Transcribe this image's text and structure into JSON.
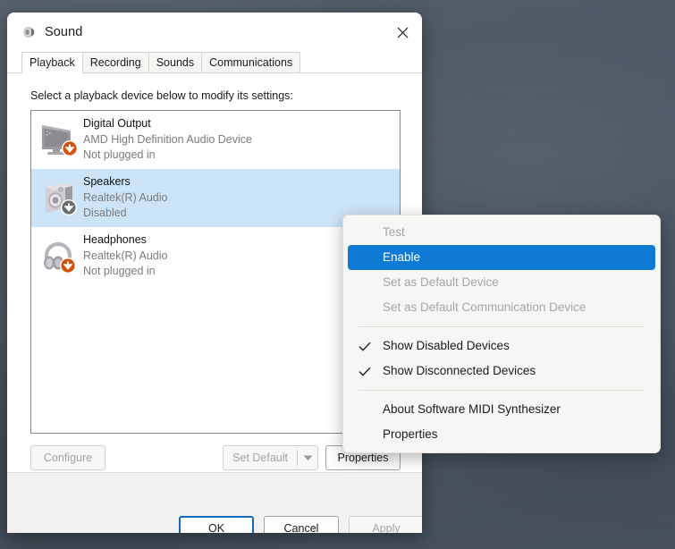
{
  "window": {
    "title": "Sound",
    "title_icon": "speaker-icon",
    "close_label": "Close",
    "close_icon": "close-icon"
  },
  "tabs": [
    {
      "label": "Playback",
      "active": true
    },
    {
      "label": "Recording",
      "active": false
    },
    {
      "label": "Sounds",
      "active": false
    },
    {
      "label": "Communications",
      "active": false
    }
  ],
  "playback": {
    "hint": "Select a playback device below to modify its settings:",
    "devices": [
      {
        "name": "Digital Output",
        "driver": "AMD High Definition Audio Device",
        "status": "Not plugged in",
        "icon": "monitor-icon",
        "badge": "down-arrow-badge",
        "badge_color": "#d4520f",
        "selected": false,
        "disabled_look": false
      },
      {
        "name": "Speakers",
        "driver": "Realtek(R) Audio",
        "status": "Disabled",
        "icon": "speaker-box-icon",
        "badge": "down-arrow-badge",
        "badge_color": "#6d6d6d",
        "selected": true,
        "disabled_look": true
      },
      {
        "name": "Headphones",
        "driver": "Realtek(R) Audio",
        "status": "Not plugged in",
        "icon": "headphones-icon",
        "badge": "down-arrow-badge",
        "badge_color": "#d4520f",
        "selected": false,
        "disabled_look": false
      }
    ]
  },
  "actions": {
    "configure": "Configure",
    "set_default": "Set Default",
    "set_default_arrow_icon": "chevron-down-icon",
    "properties": "Properties"
  },
  "footer": {
    "ok": "OK",
    "cancel": "Cancel",
    "apply": "Apply"
  },
  "context_menu": {
    "items": [
      {
        "label": "Test",
        "state": "disabled",
        "checked": false
      },
      {
        "label": "Enable",
        "state": "highlight",
        "checked": false
      },
      {
        "label": "Set as Default Device",
        "state": "disabled",
        "checked": false
      },
      {
        "label": "Set as Default Communication Device",
        "state": "disabled",
        "checked": false
      },
      {
        "label": "__separator__",
        "state": "separator",
        "checked": false
      },
      {
        "label": "Show Disabled Devices",
        "state": "normal",
        "checked": true
      },
      {
        "label": "Show Disconnected Devices",
        "state": "normal",
        "checked": true
      },
      {
        "label": "__separator__",
        "state": "separator",
        "checked": false
      },
      {
        "label": "About Software MIDI Synthesizer",
        "state": "normal",
        "checked": false
      },
      {
        "label": "Properties",
        "state": "normal",
        "checked": false
      }
    ],
    "check_icon": "checkmark-icon",
    "highlight_color": "#0f7ad4"
  }
}
